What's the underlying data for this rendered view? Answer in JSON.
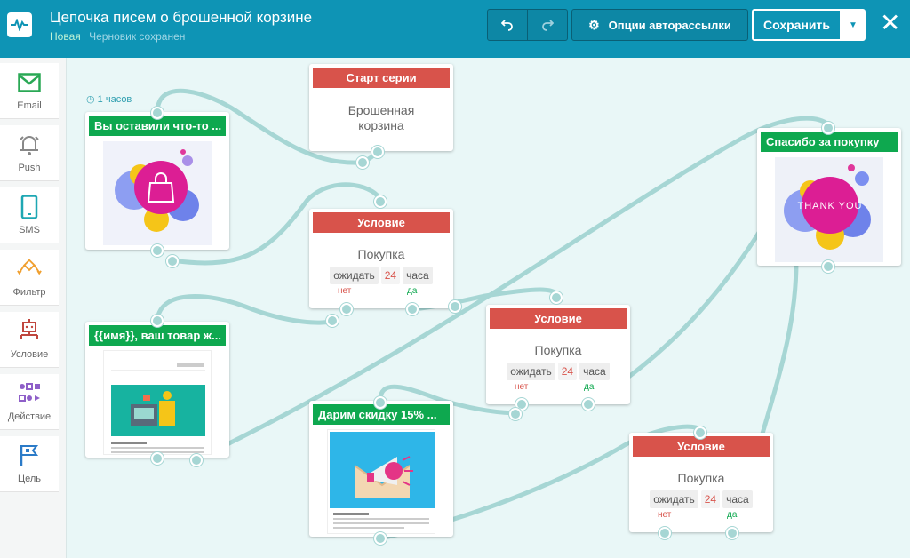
{
  "header": {
    "title": "Цепочка писем о брошенной корзине",
    "status": "Новая",
    "draft_status": "Черновик сохранен",
    "options_label": "Опции авторассылки",
    "save_label": "Сохранить"
  },
  "sidebar": {
    "items": [
      {
        "label": "Email",
        "icon": "email-icon"
      },
      {
        "label": "Push",
        "icon": "bell-icon"
      },
      {
        "label": "SMS",
        "icon": "phone-icon"
      },
      {
        "label": "Фильтр",
        "icon": "filter-icon"
      },
      {
        "label": "Условие",
        "icon": "condition-icon"
      },
      {
        "label": "Действие",
        "icon": "action-icon"
      },
      {
        "label": "Цель",
        "icon": "flag-icon"
      }
    ]
  },
  "canvas": {
    "delay_label": "1 часов",
    "start_card": {
      "header": "Старт серии",
      "body_line1": "Брошенная",
      "body_line2": "корзина"
    },
    "email1": {
      "header": "Вы оставили что-то ..."
    },
    "email2": {
      "header": "{{имя}}, ваш товар ж..."
    },
    "email3": {
      "header": "Дарим скидку 15% ..."
    },
    "email4": {
      "header": "Спасибо за покупку",
      "thumb_text": "THANK YOU"
    },
    "cond1": {
      "header": "Условие",
      "event": "Покупка",
      "wait": "ожидать",
      "num": "24",
      "unit": "часа",
      "no": "нет",
      "yes": "да"
    },
    "cond2": {
      "header": "Условие",
      "event": "Покупка",
      "wait": "ожидать",
      "num": "24",
      "unit": "часа",
      "no": "нет",
      "yes": "да"
    },
    "cond3": {
      "header": "Условие",
      "event": "Покупка",
      "wait": "ожидать",
      "num": "24",
      "unit": "часа",
      "no": "нет",
      "yes": "да"
    }
  },
  "colors": {
    "header_bg": "#0e94b5",
    "red": "#d8534b",
    "green": "#0ea84f",
    "wire": "#a6d6d4"
  }
}
